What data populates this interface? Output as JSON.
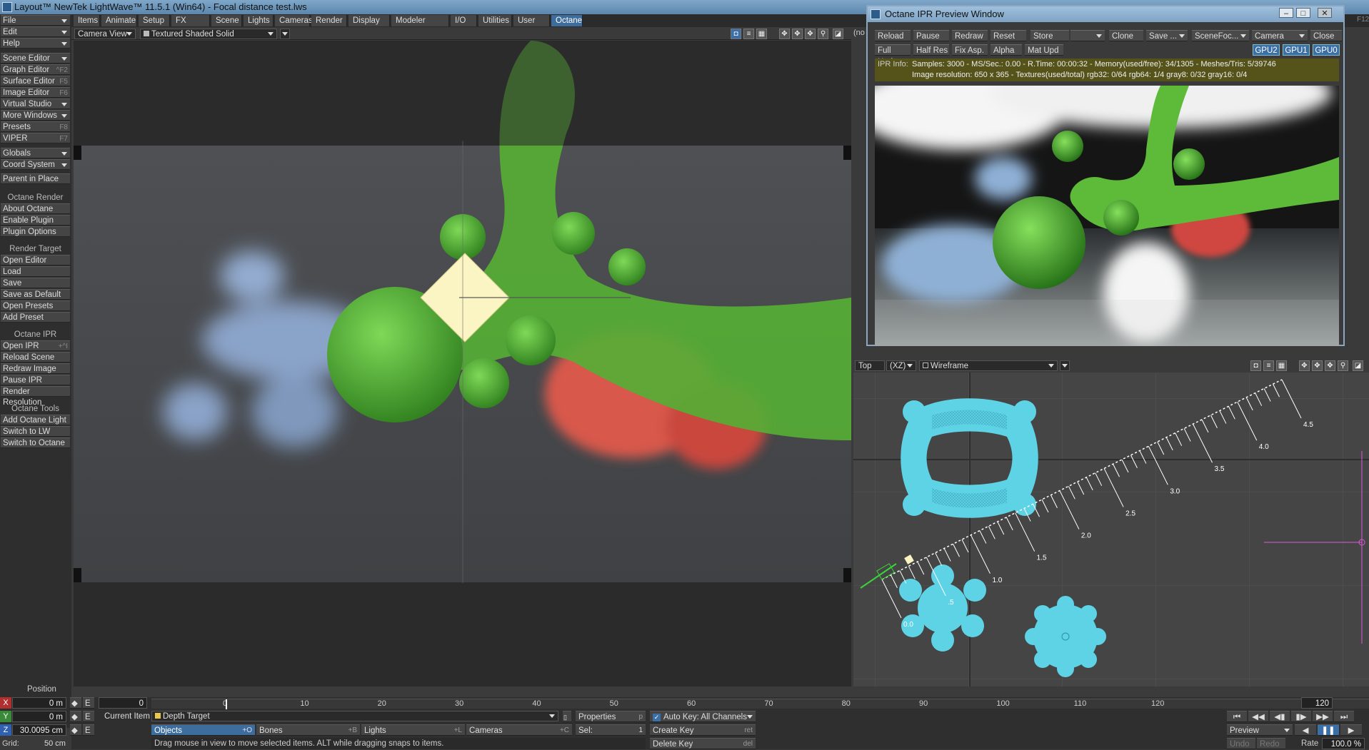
{
  "window": {
    "title": "Layout™ NewTek LightWave™ 11.5.1 (Win64) - Focal distance test.lws"
  },
  "menu_tabs": [
    "Items",
    "Animate",
    "Setup",
    "FX Tools",
    "Scene",
    "Lights",
    "Cameras",
    "Render",
    "Display",
    "Modeler Tools",
    "I/O",
    "Utilities",
    "User Tab",
    "Octane"
  ],
  "active_tab": "Octane",
  "left_panel": {
    "top_menus": [
      {
        "label": "File"
      },
      {
        "label": "Edit"
      },
      {
        "label": "Help"
      }
    ],
    "windows": [
      {
        "label": "Scene Editor",
        "shortcut": ""
      },
      {
        "label": "Graph Editor",
        "shortcut": "^F2"
      },
      {
        "label": "Surface Editor",
        "shortcut": "F5"
      },
      {
        "label": "Image Editor",
        "shortcut": "F6"
      },
      {
        "label": "Virtual Studio",
        "shortcut": ""
      },
      {
        "label": "More Windows",
        "shortcut": ""
      },
      {
        "label": "Presets",
        "shortcut": "F8"
      },
      {
        "label": "VIPER",
        "shortcut": "F7"
      }
    ],
    "globals": [
      {
        "label": "Globals"
      },
      {
        "label": "Coord System"
      },
      {
        "label": "Parent in Place"
      }
    ],
    "octane_render_header": "Octane Render",
    "octane_render": [
      "About Octane",
      "Enable Plugin",
      "Plugin Options"
    ],
    "render_target_header": "Render Target",
    "render_target": [
      "Open Editor",
      "Load",
      "Save",
      "Save as Default",
      "Open Presets Shelf",
      "Add Preset"
    ],
    "octane_ipr_header": "Octane IPR",
    "octane_ipr": [
      {
        "label": "Open IPR",
        "shortcut": "+^I"
      },
      {
        "label": "Reload Scene",
        "shortcut": ""
      },
      {
        "label": "Redraw Image",
        "shortcut": ""
      },
      {
        "label": "Pause IPR",
        "shortcut": ""
      },
      {
        "label": "Render Resolution",
        "shortcut": ""
      }
    ],
    "octane_tools_header": "Octane Tools",
    "octane_tools": [
      "Add Octane Light",
      "Switch to LW",
      "Switch to Octane"
    ]
  },
  "camera_viewport": {
    "view": "Camera View",
    "mode": "Textured Shaded Solid",
    "hidden_label": "(no"
  },
  "ipr": {
    "title": "Octane IPR Preview Window",
    "buttons_row1": [
      "Reload",
      "Pause",
      "Redraw",
      "Reset"
    ],
    "store": "Store",
    "clone": "Clone",
    "save": "Save ...",
    "scene_focus": "SceneFoc...",
    "camera": "Camera",
    "close": "Close",
    "buttons_row2": [
      "Full Upd.",
      "Half Res",
      "Fix Asp.",
      "Alpha",
      "Mat Upd"
    ],
    "gpus": [
      "GPU2",
      "GPU1",
      "GPU0"
    ],
    "info_label": "IPR Info:",
    "info_line1": "Samples: 3000  -  MS/Sec.: 0.00  -  R.Time: 00:00:32 - Memory(used/free): 34/1305  -  Meshes/Tris: 5/39746",
    "info_line2": "Image resolution: 650 x 365 - Textures(used/total) rgb32: 0/64   rgb64: 1/4   gray8: 0/32   gray16: 0/4"
  },
  "top_viewport": {
    "view": "Top",
    "axes": "(XZ)",
    "mode": "Wireframe",
    "ruler_labels": [
      "0.0",
      ".5",
      "1.0",
      "1.5",
      "2.0",
      "2.5",
      "3.0",
      "3.5",
      "4.0",
      "4.5"
    ],
    "corner_label": "F12"
  },
  "timeline": {
    "ticks": [
      "0",
      "10",
      "20",
      "30",
      "40",
      "50",
      "60",
      "70",
      "80",
      "90",
      "100",
      "110",
      "120"
    ],
    "current_frame": "0",
    "end_frame": "120"
  },
  "bottom": {
    "position_label": "Position",
    "x_label": "X",
    "x_value": "0 m",
    "y_label": "Y",
    "y_value": "0 m",
    "z_label": "Z",
    "z_value": "30.0095 cm",
    "grid_label": "Grid:",
    "grid_value": "50 cm",
    "e_label": "E",
    "frame_field": "0",
    "current_item_label": "Current Item",
    "current_item": "Depth Target",
    "properties": "Properties",
    "properties_key": "p",
    "objects": "Objects",
    "objects_key": "+O",
    "bones": "Bones",
    "bones_key": "+B",
    "lights": "Lights",
    "lights_key": "+L",
    "cameras": "Cameras",
    "cameras_key": "+C",
    "sel_label": "Sel:",
    "sel_value": "1",
    "auto_key": "Auto Key: All Channels",
    "create_key": "Create Key",
    "create_key_sc": "ret",
    "delete_key": "Delete Key",
    "delete_key_sc": "del",
    "status": "Drag mouse in view to move selected items. ALT while dragging snaps to items.",
    "preview": "Preview",
    "undo": "Undo",
    "redo": "Redo",
    "rate_label": "Rate",
    "rate_value": "100.0 %"
  },
  "colors": {
    "accent": "#3d6d9d",
    "mesh_cyan": "#5fd3e6",
    "green_blob": "#5fbe3d",
    "ipr_info_bg": "#55531a"
  }
}
